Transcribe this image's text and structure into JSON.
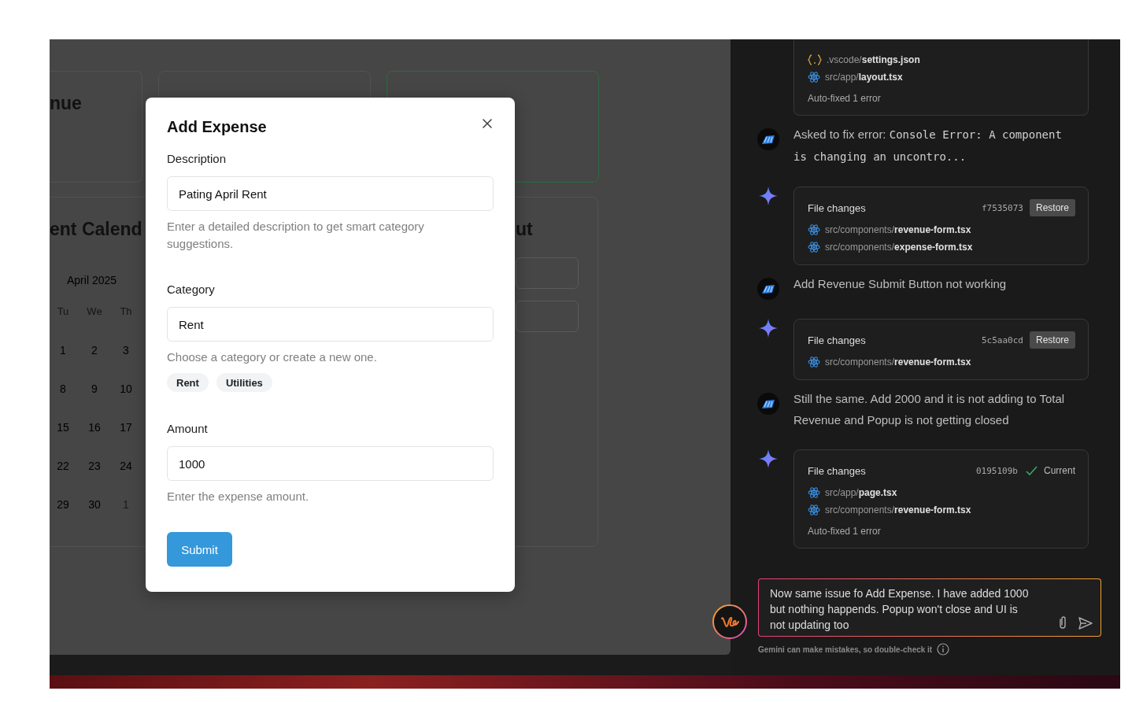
{
  "dashboard": {
    "cards": [
      {
        "kind": "plain",
        "title": "nue"
      },
      {
        "kind": "plain"
      },
      {
        "kind": "highlight"
      }
    ],
    "calendar": {
      "title": "ent Calend",
      "month": "April 2025",
      "weekdays": [
        "Tu",
        "We",
        "Th"
      ],
      "days": [
        {
          "label": "1",
          "muted": false
        },
        {
          "label": "2",
          "muted": false
        },
        {
          "label": "3",
          "muted": false
        },
        {
          "label": "8",
          "muted": false
        },
        {
          "label": "9",
          "muted": false
        },
        {
          "label": "10",
          "muted": false
        },
        {
          "label": "15",
          "muted": false
        },
        {
          "label": "16",
          "muted": false
        },
        {
          "label": "17",
          "muted": false
        },
        {
          "label": "22",
          "muted": false
        },
        {
          "label": "23",
          "muted": false
        },
        {
          "label": "24",
          "muted": false
        },
        {
          "label": "29",
          "muted": false
        },
        {
          "label": "30",
          "muted": false
        },
        {
          "label": "1",
          "muted": true
        }
      ]
    },
    "side_card": {
      "title": "ut"
    }
  },
  "modal": {
    "title": "Add Expense",
    "fields": [
      {
        "label": "Description",
        "value": "Pating April Rent",
        "hint": "Enter a detailed description to get smart category suggestions."
      },
      {
        "label": "Category",
        "value": "Rent",
        "hint": "Choose a category or create a new one.",
        "chips": [
          "Rent",
          "Utilities"
        ]
      },
      {
        "label": "Amount",
        "value": "1000",
        "hint": "Enter the expense amount."
      }
    ],
    "submit": "Submit"
  },
  "chat": {
    "messages": [
      {
        "kind": "changes",
        "files": [
          {
            "kind": "json",
            "dir": ".vscode/",
            "name": "settings.json"
          },
          {
            "kind": "react",
            "dir": "src/app/",
            "name": "layout.tsx"
          }
        ],
        "note": "Auto-fixed 1 error"
      },
      {
        "kind": "user",
        "text": "Asked to fix error: ",
        "code": "Console Error: A component is changing an uncontro..."
      },
      {
        "kind": "changes",
        "title": "File changes",
        "hash": "f7535073",
        "action": {
          "kind": "restore",
          "label": "Restore"
        },
        "files": [
          {
            "kind": "react",
            "dir": "src/components/",
            "name": "revenue-form.tsx"
          },
          {
            "kind": "react",
            "dir": "src/components/",
            "name": "expense-form.tsx"
          }
        ]
      },
      {
        "kind": "user",
        "text": "Add Revenue Submit Button not working"
      },
      {
        "kind": "changes",
        "title": "File changes",
        "hash": "5c5aa0cd",
        "action": {
          "kind": "restore",
          "label": "Restore"
        },
        "files": [
          {
            "kind": "react",
            "dir": "src/components/",
            "name": "revenue-form.tsx"
          }
        ]
      },
      {
        "kind": "user",
        "text": "Still the same. Add 2000 and it is not adding to Total Revenue and Popup is not getting closed"
      },
      {
        "kind": "changes",
        "title": "File changes",
        "hash": "0195109b",
        "action": {
          "kind": "current",
          "label": "Current"
        },
        "files": [
          {
            "kind": "react",
            "dir": "src/app/",
            "name": "page.tsx"
          },
          {
            "kind": "react",
            "dir": "src/components/",
            "name": "revenue-form.tsx"
          }
        ],
        "note": "Auto-fixed 1 error"
      }
    ],
    "prompt": {
      "value": "Now same issue fo Add Expense. I have added 1000 but nothing happends. Popup won't close and UI is not updating too"
    },
    "disclaimer": "Gemini can make mistakes, so double-check it"
  }
}
